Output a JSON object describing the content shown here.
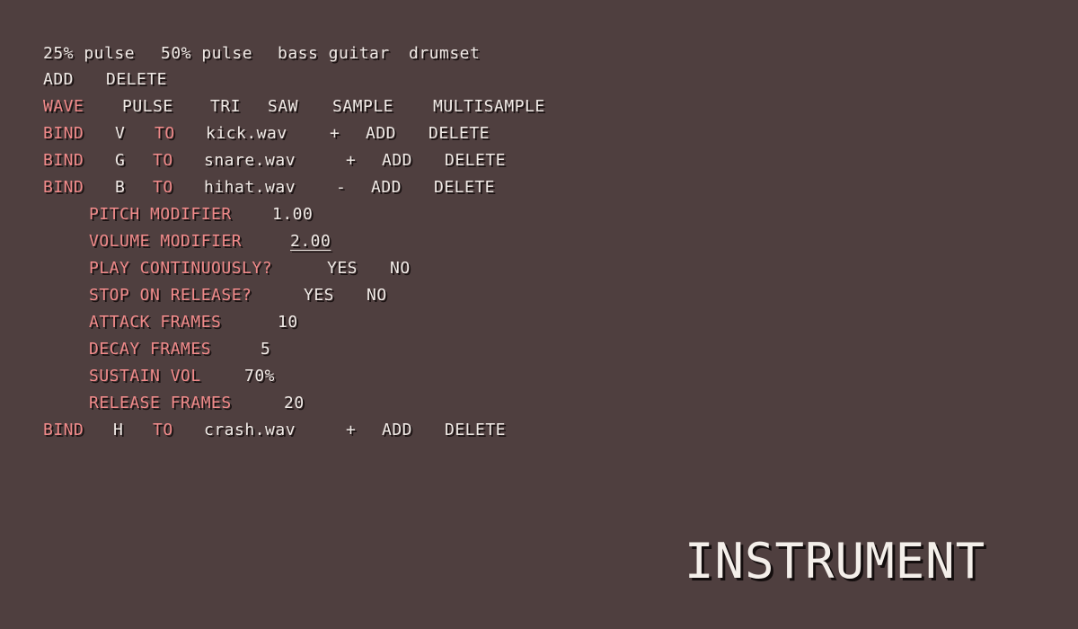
{
  "presets": [
    "25% pulse",
    "50% pulse",
    "bass guitar",
    "drumset"
  ],
  "preset_actions": {
    "add": "ADD",
    "delete": "DELETE"
  },
  "wave": {
    "label": "WAVE",
    "options": [
      "PULSE",
      "TRI",
      "SAW",
      "SAMPLE",
      "MULTISAMPLE"
    ]
  },
  "bind_label": "BIND",
  "to_label": "TO",
  "row_actions": {
    "add": "ADD",
    "delete": "DELETE"
  },
  "binds": [
    {
      "key": "V",
      "file": "kick.wav",
      "toggle": "+"
    },
    {
      "key": "G",
      "file": "snare.wav",
      "toggle": "+"
    },
    {
      "key": "B",
      "file": "hihat.wav",
      "toggle": "-"
    },
    {
      "key": "H",
      "file": "crash.wav",
      "toggle": "+"
    }
  ],
  "details": {
    "pitch": {
      "label": "PITCH MODIFIER",
      "value": "1.00"
    },
    "volume": {
      "label": "VOLUME MODIFIER",
      "value": "2.00"
    },
    "play_cont": {
      "label": "PLAY CONTINUOUSLY?",
      "yes": "YES",
      "no": "NO"
    },
    "stop_release": {
      "label": "STOP ON RELEASE?",
      "yes": "YES",
      "no": "NO"
    },
    "attack": {
      "label": "ATTACK FRAMES",
      "value": "10"
    },
    "decay": {
      "label": "DECAY FRAMES",
      "value": "5"
    },
    "sustain": {
      "label": "SUSTAIN VOL",
      "value": "70%"
    },
    "release": {
      "label": "RELEASE FRAMES",
      "value": "20"
    }
  },
  "screen_title": "INSTRUMENT",
  "colors": {
    "background": "#4f3f3f",
    "text": "#f0eae6",
    "accent": "#f08a8a"
  }
}
